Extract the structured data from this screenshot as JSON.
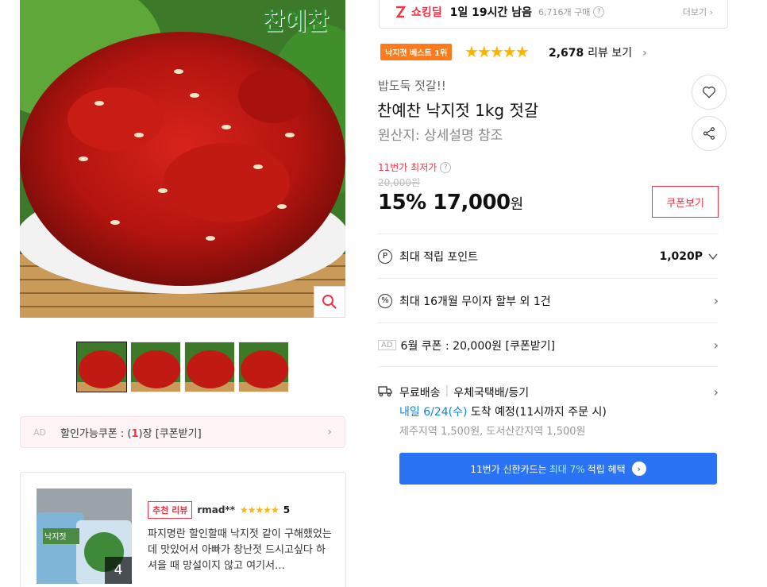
{
  "brand_logo": "찬예찬",
  "icons": {
    "zoom": "search-icon",
    "like": "heart-icon",
    "share": "share-icon",
    "point": "p-circle-icon",
    "installment": "percent-circle-icon",
    "delivery": "truck-icon"
  },
  "colors": {
    "accent": "#f43142",
    "best": "#ff7a1a",
    "star": "#ffb400",
    "banner": "#2b73f5",
    "link": "#0b83e6"
  },
  "left": {
    "ad_coupon": {
      "ad": "AD",
      "prefix": "할인가능쿠폰 : (",
      "count": "1",
      "suffix": ")장 [쿠폰받기]"
    },
    "review": {
      "badge": "추천 리뷰",
      "reviewer": "rmad**",
      "stars": "★★★★★",
      "score": "5",
      "photo_count": "4",
      "photo_label": "낙지젓",
      "text": "파지명란 할인할때 낙지젓 같이 구해했었는데 맛있어서 아빠가 창난젓 드시고싶다 하셔을 때 망설이지 않고 여기서…"
    }
  },
  "deal": {
    "label": "쇼킹딜",
    "remaining": "1일 19시간 남음",
    "buyers": "6,716개 구매",
    "help": "?",
    "more": "더보기 ›"
  },
  "product": {
    "best_badge": "낙지젓 베스트 1위",
    "stars": "★★★★★",
    "rating": 4.5,
    "review_count": "2,678",
    "review_label": "리뷰 보기",
    "subtitle": "밥도둑 젓갈!!",
    "title": "찬예찬 낙지젓 1kg 젓갈",
    "origin": "원산지:  상세설명 참조"
  },
  "price": {
    "lowest_label": "11번가 최저가",
    "help": "?",
    "original": "20,000원",
    "discount": "15%",
    "sale": "17,000",
    "unit": "원",
    "coupon_button": "쿠폰보기"
  },
  "rows": {
    "point": {
      "icon": "P",
      "label": "최대 적립 포인트",
      "value": "1,020P"
    },
    "installment": {
      "icon": "%",
      "label": "최대 16개월 무이자 할부 외 1건"
    },
    "ad_coupon": {
      "ad": "AD",
      "label": "6월 쿠폰 : 20,000원 [쿠폰받기]"
    },
    "shipping": {
      "free": "무료배송",
      "method": "우체국택배/등기",
      "date_blue": "내일 6/24(수)",
      "date_rest": " 도착 예정(11시까지 주문 시)",
      "extra": "제주지역 1,500원, 도서산간지역 1,500원"
    }
  },
  "banner": {
    "prefix": "11번가 신한카드는",
    "highlight": "최대 7%",
    "suffix": "적립 혜택",
    "go": "›"
  }
}
